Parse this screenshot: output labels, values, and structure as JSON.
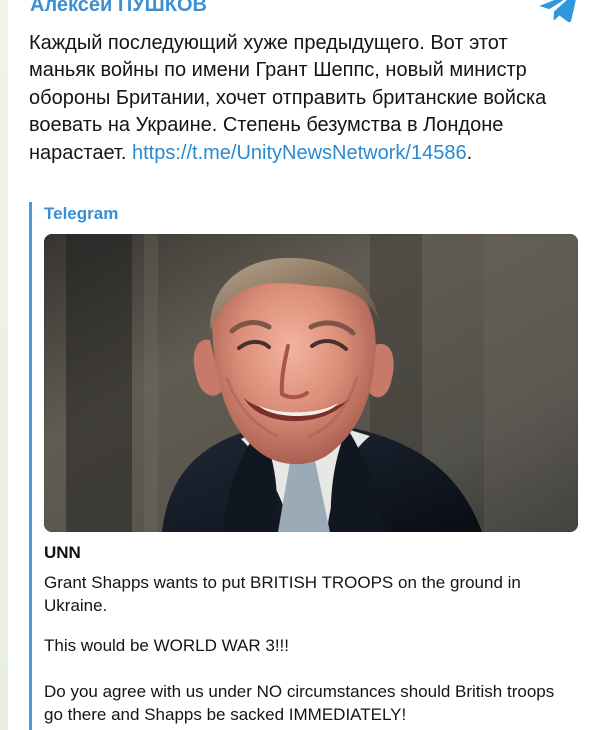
{
  "post": {
    "author": "Алексей ПУШКОВ",
    "icon": "telegram-icon",
    "message_text": "Каждый последующий хуже предыдущего. Вот этот маньяк войны по имени Грант Шеппс, новый министр обороны Британии, хочет отправить британские войска воевать на Украине. Степень безумства в Лондоне нарастает. ",
    "link_text": "https://t.me/UnityNewsNetwork/14586",
    "link_suffix": "."
  },
  "quote": {
    "source": "Telegram",
    "photo_subject": "smiling man in dark suit",
    "title": "UNN",
    "paragraph_1": "Grant Shapps wants to put BRITISH TROOPS on the ground in Ukraine.",
    "paragraph_2": "This would be WORLD WAR 3!!!",
    "paragraph_3": "Do you agree with us under NO circumstances should British troops go there and Shapps be sacked IMMEDIATELY!"
  },
  "colors": {
    "accent": "#3f8fd3",
    "link": "#2b89d0",
    "quote_bar": "#4b99d8"
  }
}
